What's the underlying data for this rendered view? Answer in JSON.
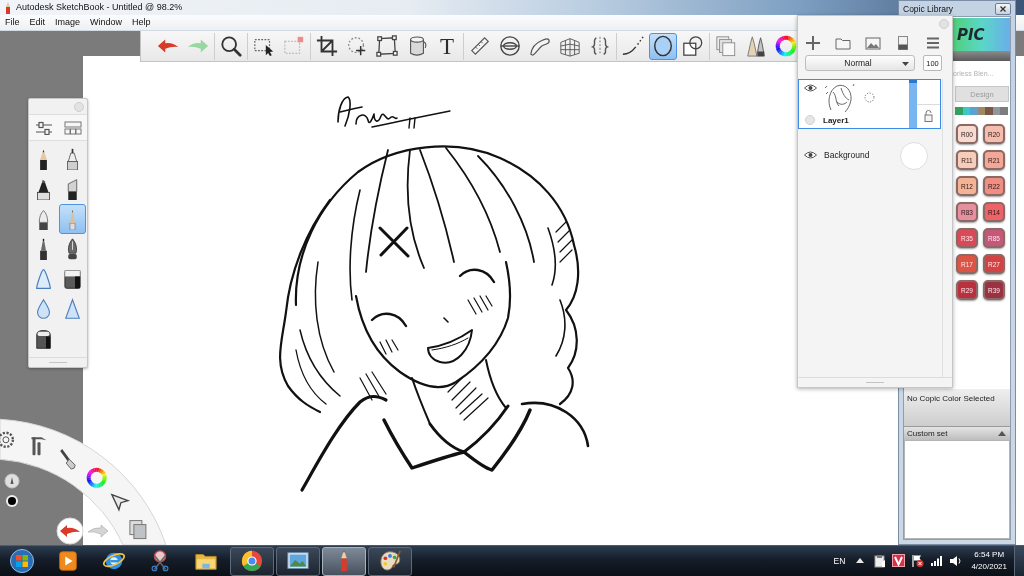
{
  "window": {
    "title": "Autodesk SketchBook - Untitled @ 98.2%"
  },
  "menu_bar": {
    "items": [
      "File",
      "Edit",
      "Image",
      "Window",
      "Help"
    ]
  },
  "toolbar": {
    "groups": [
      [
        {
          "kind": "undo",
          "selected": false
        },
        {
          "kind": "redo",
          "selected": false
        }
      ],
      [
        {
          "kind": "zoom",
          "selected": false
        }
      ],
      [
        {
          "kind": "select",
          "selected": false
        },
        {
          "kind": "clear-selection",
          "selected": false
        }
      ],
      [
        {
          "kind": "crop",
          "selected": false
        },
        {
          "kind": "transform",
          "selected": false
        },
        {
          "kind": "distort",
          "selected": false
        },
        {
          "kind": "fill",
          "selected": false
        },
        {
          "kind": "text",
          "selected": false,
          "glyph": "T"
        }
      ],
      [
        {
          "kind": "ruler",
          "selected": false
        },
        {
          "kind": "ellipse-guide",
          "selected": false
        },
        {
          "kind": "french-curve",
          "selected": false
        },
        {
          "kind": "perspective",
          "selected": false
        },
        {
          "kind": "symmetry",
          "selected": false
        }
      ],
      [
        {
          "kind": "stroke",
          "selected": false
        },
        {
          "kind": "ellipse",
          "selected": true
        },
        {
          "kind": "shapes",
          "selected": false
        }
      ],
      [
        {
          "kind": "layers",
          "selected": false
        },
        {
          "kind": "brushes",
          "selected": false
        },
        {
          "kind": "color",
          "selected": false
        }
      ]
    ]
  },
  "brush_palette": {
    "tools": [
      {
        "kind": "properties"
      },
      {
        "kind": "library"
      }
    ],
    "brushes": [
      {
        "kind": "pencil",
        "selected": false
      },
      {
        "kind": "ink-pen",
        "selected": false
      },
      {
        "kind": "marker",
        "selected": false
      },
      {
        "kind": "chisel-marker",
        "selected": false
      },
      {
        "kind": "airbrush",
        "selected": false
      },
      {
        "kind": "fine-pencil",
        "selected": true
      },
      {
        "kind": "ballpoint",
        "selected": false
      },
      {
        "kind": "fountain-pen",
        "selected": false
      },
      {
        "kind": "smudge",
        "selected": false
      },
      {
        "kind": "hard-eraser",
        "selected": false
      },
      {
        "kind": "blur",
        "selected": false
      },
      {
        "kind": "sharpen",
        "selected": false
      },
      {
        "kind": "soft-eraser",
        "selected": false
      }
    ]
  },
  "layers_panel": {
    "actions": [
      {
        "kind": "add"
      },
      {
        "kind": "folder"
      },
      {
        "kind": "image"
      },
      {
        "kind": "block"
      },
      {
        "kind": "menu"
      }
    ],
    "blend_mode": "Normal",
    "opacity": "100",
    "layers": [
      {
        "kind": "paint",
        "name": "Layer1",
        "visible": true,
        "selected": true
      },
      {
        "kind": "background",
        "name": "Background",
        "visible": true,
        "selected": false
      }
    ]
  },
  "copic_library": {
    "title": "Copic Library",
    "logo": "PIC",
    "blender": "orless Blen...",
    "tabs": [
      {
        "label": "Design",
        "selected": false
      }
    ],
    "families": [
      {
        "color": "#33a060"
      },
      {
        "color": "#3cc8c4"
      },
      {
        "color": "#5aa2d2"
      },
      {
        "color": "#9e8868"
      },
      {
        "color": "#7b5746"
      },
      {
        "color": "#8f979f"
      },
      {
        "color": "#7d7d7d"
      }
    ],
    "swatches": [
      {
        "label": "R00",
        "color": "#f7d9cf"
      },
      {
        "label": "R20",
        "color": "#f6bcae"
      },
      {
        "label": "R11",
        "color": "#f7cdb9"
      },
      {
        "label": "R21",
        "color": "#f2a797"
      },
      {
        "label": "R12",
        "color": "#f5b396"
      },
      {
        "label": "R22",
        "color": "#f08e84"
      },
      {
        "label": "R83",
        "color": "#e68fa0"
      },
      {
        "label": "R14",
        "color": "#ec6468"
      },
      {
        "label": "R35",
        "color": "#d94a58"
      },
      {
        "label": "R85",
        "color": "#c4577a"
      },
      {
        "label": "R17",
        "color": "#dd5444"
      },
      {
        "label": "R27",
        "color": "#d24444"
      },
      {
        "label": "R29",
        "color": "#b9303f"
      },
      {
        "label": "R39",
        "color": "#9a3243"
      }
    ],
    "status": "No Copic Color Selected",
    "custom_set": {
      "label": "Custom set",
      "expanded": true
    }
  },
  "lagoon": {
    "items": [
      {
        "kind": "settings"
      },
      {
        "kind": "tools"
      },
      {
        "kind": "brush"
      },
      {
        "kind": "color"
      },
      {
        "kind": "select"
      },
      {
        "kind": "layers"
      }
    ],
    "history": [
      {
        "kind": "undo"
      },
      {
        "kind": "redo"
      }
    ]
  },
  "taskbar": {
    "items": [
      {
        "kind": "start",
        "running": false,
        "selected": false
      },
      {
        "kind": "media-player",
        "running": false,
        "selected": false
      },
      {
        "kind": "e-browser",
        "running": false,
        "selected": false
      },
      {
        "kind": "snipping",
        "running": false,
        "selected": false
      },
      {
        "kind": "explorer",
        "running": false,
        "selected": false
      },
      {
        "kind": "round-browser",
        "running": true,
        "selected": false
      },
      {
        "kind": "photo-viewer",
        "running": true,
        "selected": false
      },
      {
        "kind": "sketchbook",
        "running": true,
        "selected": true
      },
      {
        "kind": "paint",
        "running": true,
        "selected": false
      }
    ],
    "tray": {
      "language": "EN",
      "icons": [
        {
          "kind": "show-hidden"
        },
        {
          "kind": "clipboard"
        },
        {
          "kind": "v-shield"
        },
        {
          "kind": "flag-alert"
        },
        {
          "kind": "signal"
        },
        {
          "kind": "volume"
        }
      ],
      "time": "6:54 PM",
      "date": "4/20/2021"
    }
  }
}
